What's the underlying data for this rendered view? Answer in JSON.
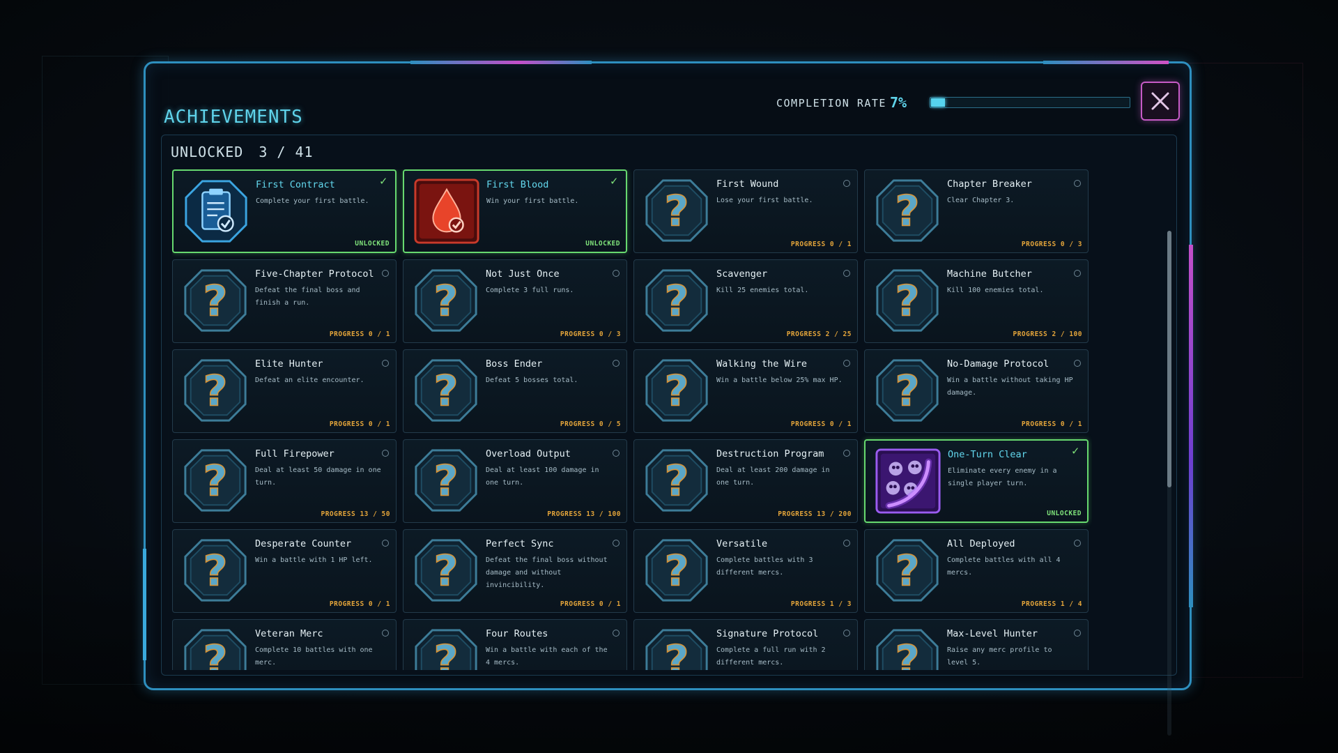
{
  "header": {
    "title": "ACHIEVEMENTS",
    "completion_label": "COMPLETION RATE",
    "completion_pct": "7%",
    "completion_fraction": 0.07,
    "close_icon": "close-icon"
  },
  "summary": {
    "unlocked_label": "UNLOCKED",
    "unlocked_count": "3 / 41"
  },
  "colors": {
    "accent_cyan": "#5fd3ea",
    "unlocked_green": "#67d96f",
    "progress_orange": "#e3a43a",
    "close_pink": "#c75bc6"
  },
  "achievements": [
    {
      "name": "First Contract",
      "desc": "Complete your first battle.",
      "footer": "UNLOCKED",
      "unlocked": true,
      "icon": "clipboard-check-icon"
    },
    {
      "name": "First Blood",
      "desc": "Win your first battle.",
      "footer": "UNLOCKED",
      "unlocked": true,
      "icon": "blood-drop-icon"
    },
    {
      "name": "First Wound",
      "desc": "Lose your first battle.",
      "footer": "PROGRESS 0 / 1",
      "unlocked": false,
      "icon": "mystery-icon"
    },
    {
      "name": "Chapter Breaker",
      "desc": "Clear Chapter 3.",
      "footer": "PROGRESS 0 / 3",
      "unlocked": false,
      "icon": "mystery-icon"
    },
    {
      "name": "Five-Chapter Protocol",
      "desc": "Defeat the final boss and finish a run.",
      "footer": "PROGRESS 0 / 1",
      "unlocked": false,
      "icon": "mystery-icon"
    },
    {
      "name": "Not Just Once",
      "desc": "Complete 3 full runs.",
      "footer": "PROGRESS 0 / 3",
      "unlocked": false,
      "icon": "mystery-icon"
    },
    {
      "name": "Scavenger",
      "desc": "Kill 25 enemies total.",
      "footer": "PROGRESS 2 / 25",
      "unlocked": false,
      "icon": "mystery-icon"
    },
    {
      "name": "Machine Butcher",
      "desc": "Kill 100 enemies total.",
      "footer": "PROGRESS 2 / 100",
      "unlocked": false,
      "icon": "mystery-icon"
    },
    {
      "name": "Elite Hunter",
      "desc": "Defeat an elite encounter.",
      "footer": "PROGRESS 0 / 1",
      "unlocked": false,
      "icon": "mystery-icon"
    },
    {
      "name": "Boss Ender",
      "desc": "Defeat 5 bosses total.",
      "footer": "PROGRESS 0 / 5",
      "unlocked": false,
      "icon": "mystery-icon"
    },
    {
      "name": "Walking the Wire",
      "desc": "Win a battle below 25% max HP.",
      "footer": "PROGRESS 0 / 1",
      "unlocked": false,
      "icon": "mystery-icon"
    },
    {
      "name": "No-Damage Protocol",
      "desc": "Win a battle without taking HP damage.",
      "footer": "PROGRESS 0 / 1",
      "unlocked": false,
      "icon": "mystery-icon"
    },
    {
      "name": "Full Firepower",
      "desc": "Deal at least 50 damage in one turn.",
      "footer": "PROGRESS 13 / 50",
      "unlocked": false,
      "icon": "mystery-icon"
    },
    {
      "name": "Overload Output",
      "desc": "Deal at least 100 damage in one turn.",
      "footer": "PROGRESS 13 / 100",
      "unlocked": false,
      "icon": "mystery-icon"
    },
    {
      "name": "Destruction Program",
      "desc": "Deal at least 200 damage in one turn.",
      "footer": "PROGRESS 13 / 200",
      "unlocked": false,
      "icon": "mystery-icon"
    },
    {
      "name": "One-Turn Clear",
      "desc": "Eliminate every enemy in a single player turn.",
      "footer": "UNLOCKED",
      "unlocked": true,
      "icon": "skull-slash-icon"
    },
    {
      "name": "Desperate Counter",
      "desc": "Win a battle with 1 HP left.",
      "footer": "PROGRESS 0 / 1",
      "unlocked": false,
      "icon": "mystery-icon"
    },
    {
      "name": "Perfect Sync",
      "desc": "Defeat the final boss without damage and without invincibility.",
      "footer": "PROGRESS 0 / 1",
      "unlocked": false,
      "icon": "mystery-icon"
    },
    {
      "name": "Versatile",
      "desc": "Complete battles with 3 different mercs.",
      "footer": "PROGRESS 1 / 3",
      "unlocked": false,
      "icon": "mystery-icon"
    },
    {
      "name": "All Deployed",
      "desc": "Complete battles with all 4 mercs.",
      "footer": "PROGRESS 1 / 4",
      "unlocked": false,
      "icon": "mystery-icon"
    },
    {
      "name": "Veteran Merc",
      "desc": "Complete 10 battles with one merc.",
      "footer": "",
      "unlocked": false,
      "icon": "mystery-icon"
    },
    {
      "name": "Four Routes",
      "desc": "Win a battle with each of the 4 mercs.",
      "footer": "",
      "unlocked": false,
      "icon": "mystery-icon"
    },
    {
      "name": "Signature Protocol",
      "desc": "Complete a full run with 2 different mercs.",
      "footer": "",
      "unlocked": false,
      "icon": "mystery-icon"
    },
    {
      "name": "Max-Level Hunter",
      "desc": "Raise any merc profile to level 5.",
      "footer": "",
      "unlocked": false,
      "icon": "mystery-icon"
    }
  ]
}
